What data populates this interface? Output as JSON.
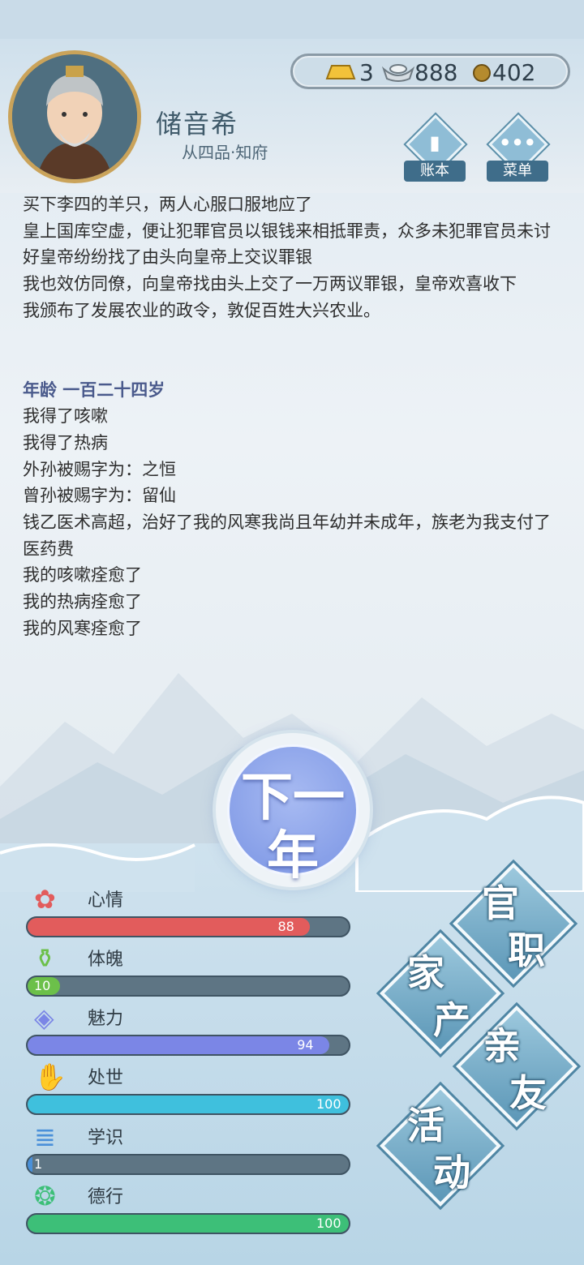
{
  "player": {
    "name": "储音希",
    "rank": "从四品·知府"
  },
  "currency": {
    "gold": "3",
    "silver": "888",
    "coins": "402"
  },
  "header_buttons": {
    "ledger": "账本",
    "menu": "菜单"
  },
  "log": {
    "lines_a": [
      "买下李四的羊只，两人心服口服地应了",
      "皇上国库空虚，便让犯罪官员以银钱来相抵罪责，众多未犯罪官员未讨好皇帝纷纷找了由头向皇帝上交议罪银",
      "我也效仿同僚，向皇帝找由头上交了一万两议罪银，皇帝欢喜收下",
      "我颁布了发展农业的政令，敦促百姓大兴农业。"
    ],
    "age_heading": "年龄 一百二十四岁",
    "lines_b": [
      "我得了咳嗽",
      "我得了热病",
      "外孙被赐字为：之恒",
      "曾孙被赐字为：留仙",
      "钱乙医术高超，治好了我的风寒我尚且年幼并未成年，族老为我支付了医药费",
      "我的咳嗽痊愈了",
      "我的热病痊愈了",
      "我的风寒痊愈了"
    ]
  },
  "next_year": {
    "line1": "下一",
    "line2": "年"
  },
  "stats": [
    {
      "name": "心情",
      "value": 88,
      "display": "88",
      "fill": 0.88,
      "color": "#e25c5c",
      "icon": "flower-icon"
    },
    {
      "name": "体魄",
      "value": 10,
      "display": "10",
      "fill": 0.1,
      "color": "#6cc04a",
      "icon": "bronze-vessel-icon"
    },
    {
      "name": "魅力",
      "value": 94,
      "display": "94",
      "fill": 0.94,
      "color": "#7b86e6",
      "icon": "mirror-icon"
    },
    {
      "name": "处世",
      "value": 100,
      "display": "100",
      "fill": 1.0,
      "color": "#3fc0dd",
      "icon": "hands-icon"
    },
    {
      "name": "学识",
      "value": 1,
      "display": "1",
      "fill": 0.01,
      "color": "#4a90d9",
      "icon": "bamboo-scroll-icon"
    },
    {
      "name": "德行",
      "value": 100,
      "display": "100",
      "fill": 1.0,
      "color": "#3dbf78",
      "icon": "jade-pendant-icon"
    }
  ],
  "menu": {
    "official": [
      "官",
      "职"
    ],
    "family_property": [
      "家",
      "产"
    ],
    "relatives": [
      "亲",
      "友"
    ],
    "activities": [
      "活",
      "动"
    ]
  }
}
